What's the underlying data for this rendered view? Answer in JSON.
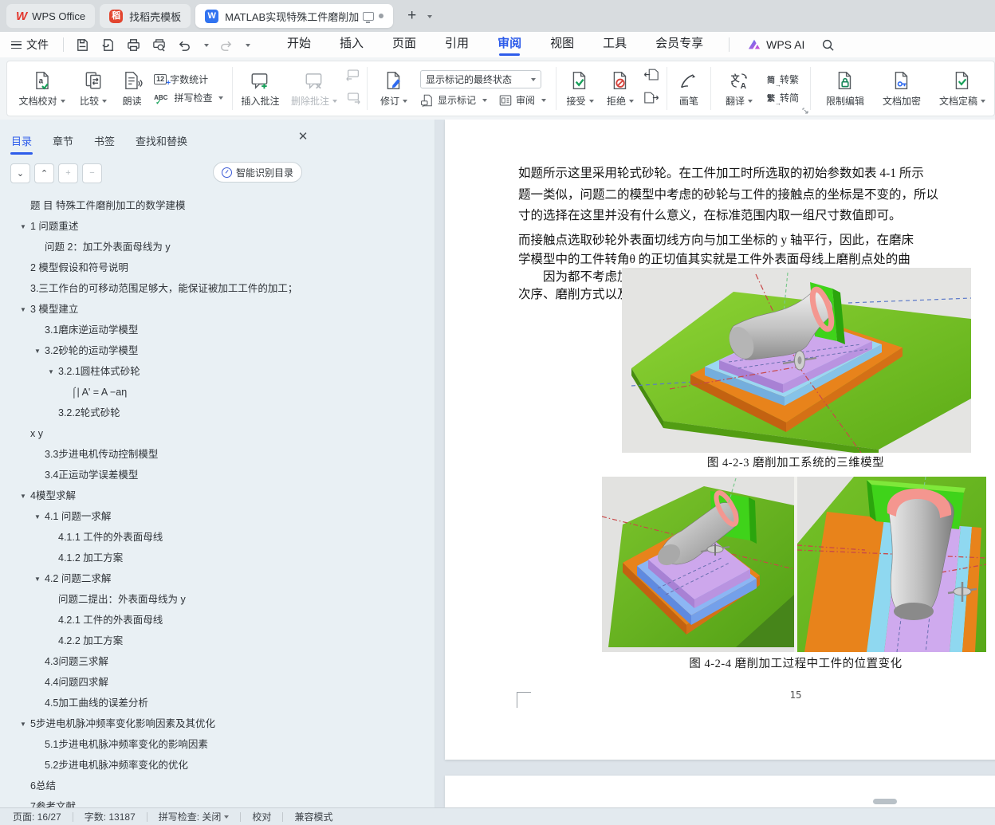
{
  "window": {
    "tabs": [
      {
        "label": "WPS Office"
      },
      {
        "label": "找稻壳模板"
      },
      {
        "label": "MATLAB实现特殊工件磨削加"
      }
    ]
  },
  "menubar": {
    "file": "文件",
    "tabs": [
      {
        "label": "开始"
      },
      {
        "label": "插入"
      },
      {
        "label": "页面"
      },
      {
        "label": "引用"
      },
      {
        "label": "审阅",
        "active": true
      },
      {
        "label": "视图"
      },
      {
        "label": "工具"
      },
      {
        "label": "会员专享"
      }
    ],
    "wps_ai": "WPS AI"
  },
  "ribbon": {
    "doc_proof": "文档校对",
    "compare": "比较",
    "read_aloud": "朗读",
    "word_count": "字数统计",
    "spell_check": "拼写检查",
    "icon_12": "12",
    "icon_abc": "ABC",
    "insert_comment": "插入批注",
    "delete_comment": "删除批注",
    "track_changes": "修订",
    "markup_state": "显示标记的最终状态",
    "show_markup": "显示标记",
    "review": "审阅",
    "accept": "接受",
    "reject": "拒绝",
    "pen": "画笔",
    "translate": "翻译",
    "jian": "简",
    "fan": "繁",
    "to_traditional": "转繁",
    "to_simplified": "转简",
    "restrict_edit": "限制编辑",
    "encrypt": "文档加密",
    "finalize": "文档定稿"
  },
  "sidebar": {
    "tabs": [
      {
        "label": "目录",
        "active": true
      },
      {
        "label": "章节"
      },
      {
        "label": "书签"
      },
      {
        "label": "查找和替换"
      }
    ],
    "smart_toc": "智能识别目录",
    "toc": [
      {
        "text": "题 目 特殊工件磨削加工的数学建模",
        "indent": 1
      },
      {
        "text": "1 问题重述",
        "indent": 1,
        "expand": true
      },
      {
        "text": "问题 2：加工外表面母线为 y",
        "indent": 2
      },
      {
        "text": "2 模型假设和符号说明",
        "indent": 1
      },
      {
        "text": "3.三工作台的可移动范围足够大，能保证被加工工件的加工；",
        "indent": 1
      },
      {
        "text": "3 模型建立",
        "indent": 1,
        "expand": true
      },
      {
        "text": "3.1磨床逆运动学模型",
        "indent": 2
      },
      {
        "text": "3.2砂轮的运动学模型",
        "indent": 2,
        "expand": true
      },
      {
        "text": "3.2.1圆柱体式砂轮",
        "indent": 3,
        "expand": true
      },
      {
        "text": "⌠| A' = A −aη",
        "indent": 4
      },
      {
        "text": "3.2.2轮式砂轮",
        "indent": 3
      },
      {
        "text": "x y",
        "indent": 1
      },
      {
        "text": "3.3步进电机传动控制模型",
        "indent": 2
      },
      {
        "text": "3.4正运动学误差模型",
        "indent": 2
      },
      {
        "text": "4模型求解",
        "indent": 1,
        "expand": true
      },
      {
        "text": "4.1 问题一求解",
        "indent": 2,
        "expand": true
      },
      {
        "text": "4.1.1 工件的外表面母线",
        "indent": 3
      },
      {
        "text": "4.1.2 加工方案",
        "indent": 3
      },
      {
        "text": "4.2 问题二求解",
        "indent": 2,
        "expand": true
      },
      {
        "text": "问题二提出：外表面母线为 y",
        "indent": 3
      },
      {
        "text": "4.2.1 工件的外表面母线",
        "indent": 3
      },
      {
        "text": "4.2.2 加工方案",
        "indent": 3
      },
      {
        "text": "4.3问题三求解",
        "indent": 2
      },
      {
        "text": "4.4问题四求解",
        "indent": 2
      },
      {
        "text": "4.5加工曲线的误差分析",
        "indent": 2
      },
      {
        "text": "5步进电机脉冲频率变化影响因素及其优化",
        "indent": 1,
        "expand": true
      },
      {
        "text": "5.1步进电机脉冲频率变化的影响因素",
        "indent": 2
      },
      {
        "text": "5.2步进电机脉冲频率变化的优化",
        "indent": 2
      },
      {
        "text": "6总结",
        "indent": 1
      },
      {
        "text": "7参考文献",
        "indent": 1
      }
    ]
  },
  "document": {
    "para1": [
      "如题所示这里采用轮式砂轮。在工件加工时所选取的初始参数如表 4-1 所示",
      "题一类似，问题二的模型中考虑的砂轮与工件的接触点的坐标是不变的，所以",
      "寸的选择在这里并没有什么意义，在标准范围内取一组尺寸数值即可。"
    ],
    "para2": [
      "而接触点选取砂轮外表面切线方向与加工坐标的 y 轴平行，因此，在磨床"
    ],
    "para3": [
      "学模型中的工件转角θ 的正切值其实就是工件外表面母线上磨削点处的曲",
      "　　因为都不考虑加工点相对机床坐标的变化，所以问题二中的加工基准",
      "次序、磨削方式以及模型求解等都与问题一相同。"
    ],
    "fig1_caption": "图 4-2-3 磨削加工系统的三维模型",
    "fig2_caption": "图 4-2-4 磨削加工过程中工件的位置变化",
    "page_number": "15"
  },
  "statusbar": {
    "page": "页面: 16/27",
    "words": "字数: 13187",
    "spell": "拼写检查: 关闭",
    "proofread": "校对",
    "mode": "兼容模式"
  }
}
